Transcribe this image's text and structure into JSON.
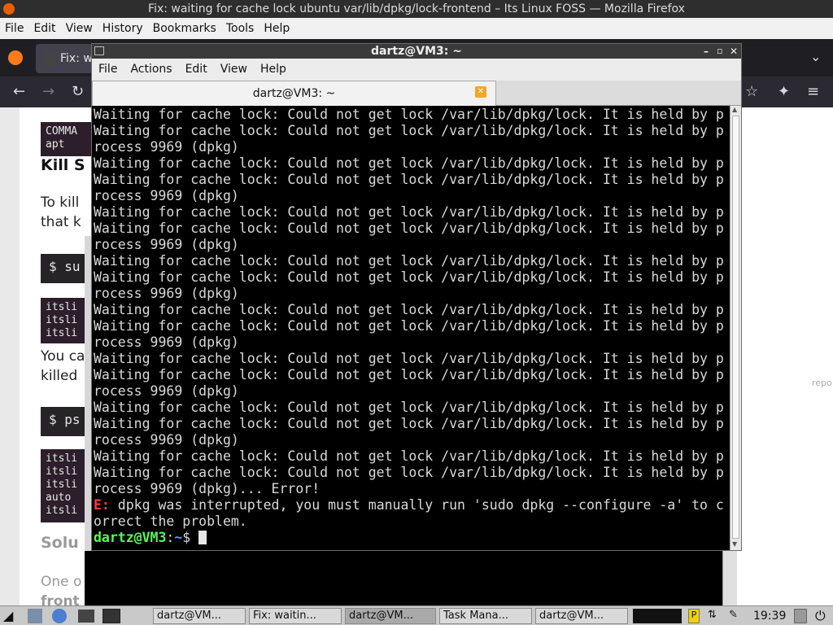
{
  "firefox": {
    "window_title": "Fix: waiting for cache lock ubuntu var/lib/dpkg/lock-frontend – Its Linux FOSS — Mozilla Firefox",
    "menu": [
      "File",
      "Edit",
      "View",
      "History",
      "Bookmarks",
      "Tools",
      "Help"
    ],
    "tab_label": "Fix: w",
    "page": {
      "cmd_box_1": [
        "COMMA",
        "apt"
      ],
      "heading_1": "Kill S",
      "para_1_line_1": "To kill",
      "para_1_line_2": "that k",
      "cmd_1": "$ su",
      "cmd_box_2": [
        "itsli",
        "itsli",
        "itsli"
      ],
      "para_2_line_1": "You ca",
      "para_2_line_2": "killed",
      "cmd_2": "$ ps",
      "cmd_box_3": [
        "itsli",
        "itsli",
        "itsli",
        "auto",
        "itsli"
      ],
      "heading_2": "Solu",
      "para_3": "One o",
      "para_3b": "front",
      "report_label": "repo"
    }
  },
  "terminal": {
    "title": "dartz@VM3: ~",
    "menu": [
      "File",
      "Actions",
      "Edit",
      "View",
      "Help"
    ],
    "tab_title": "dartz@VM3: ~",
    "lines": [
      "Waiting for cache lock: Could not get lock /var/lib/dpkg/lock. It is held by p",
      "Waiting for cache lock: Could not get lock /var/lib/dpkg/lock. It is held by p",
      "rocess 9969 (dpkg)",
      "Waiting for cache lock: Could not get lock /var/lib/dpkg/lock. It is held by p",
      "Waiting for cache lock: Could not get lock /var/lib/dpkg/lock. It is held by p",
      "rocess 9969 (dpkg)",
      "Waiting for cache lock: Could not get lock /var/lib/dpkg/lock. It is held by p",
      "Waiting for cache lock: Could not get lock /var/lib/dpkg/lock. It is held by p",
      "rocess 9969 (dpkg)",
      "Waiting for cache lock: Could not get lock /var/lib/dpkg/lock. It is held by p",
      "Waiting for cache lock: Could not get lock /var/lib/dpkg/lock. It is held by p",
      "rocess 9969 (dpkg)",
      "Waiting for cache lock: Could not get lock /var/lib/dpkg/lock. It is held by p",
      "Waiting for cache lock: Could not get lock /var/lib/dpkg/lock. It is held by p",
      "rocess 9969 (dpkg)",
      "Waiting for cache lock: Could not get lock /var/lib/dpkg/lock. It is held by p",
      "Waiting for cache lock: Could not get lock /var/lib/dpkg/lock. It is held by p",
      "rocess 9969 (dpkg)",
      "Waiting for cache lock: Could not get lock /var/lib/dpkg/lock. It is held by p",
      "Waiting for cache lock: Could not get lock /var/lib/dpkg/lock. It is held by p",
      "rocess 9969 (dpkg)",
      "Waiting for cache lock: Could not get lock /var/lib/dpkg/lock. It is held by p",
      "Waiting for cache lock: Could not get lock /var/lib/dpkg/lock. It is held by p",
      "rocess 9969 (dpkg)... Error!"
    ],
    "error_prefix": "E:",
    "error_line_1": " dpkg was interrupted, you must manually run 'sudo dpkg --configure -a' to c",
    "error_line_2": "orrect the problem.",
    "prompt_user": "dartz@VM3",
    "prompt_sep": ":",
    "prompt_path": "~",
    "prompt_sign": "$ "
  },
  "taskbar": {
    "buttons": [
      "dartz@VM...",
      "Fix: waitin...",
      "dartz@VM...",
      "Task Mana...",
      "dartz@VM..."
    ],
    "clock": "19:39"
  },
  "colors": {
    "terminal_bg": "#000000",
    "error_red": "#ff3b3b",
    "prompt_green": "#5af55a",
    "prompt_blue": "#6f8cff"
  }
}
